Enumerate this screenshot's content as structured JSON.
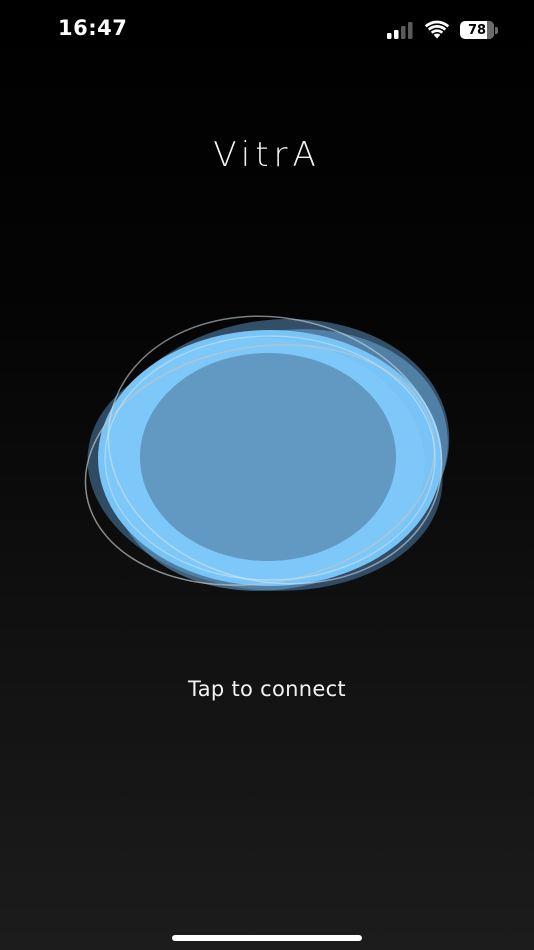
{
  "status_bar": {
    "time": "16:47",
    "battery_level": "78",
    "icons": [
      "cellular-signal-icon",
      "wifi-icon",
      "battery-icon"
    ]
  },
  "app": {
    "logo_text": "VitrA",
    "connect_prompt": "Tap to connect"
  },
  "colors": {
    "accent": "#78c4f6",
    "orb_center": "#6199c2",
    "background_top": "#000000",
    "background_bottom": "#1d1c1d"
  }
}
